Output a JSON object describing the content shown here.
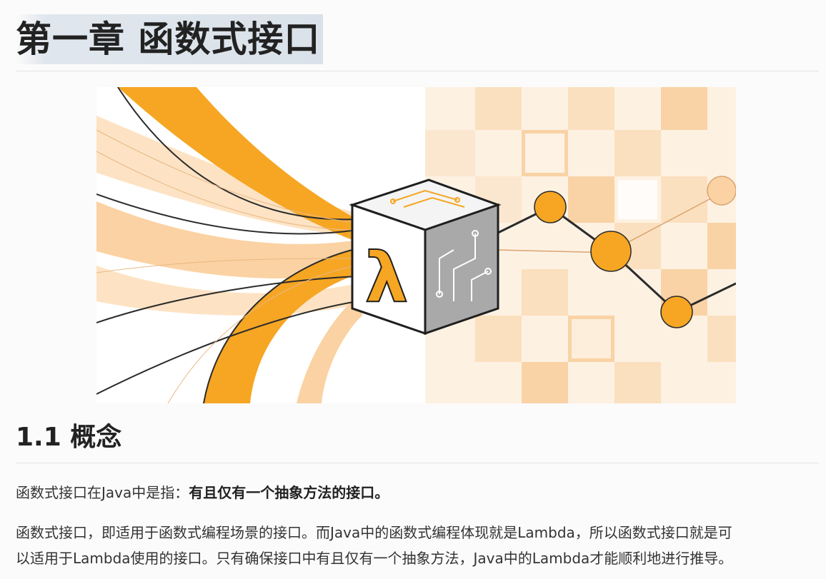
{
  "chapter": {
    "title": "第一章 函数式接口"
  },
  "hero_image": {
    "symbol": "λ",
    "accent_color": "#f6a623",
    "dark_color": "#1f1f1f"
  },
  "section": {
    "title": "1.1 概念",
    "paragraph1": {
      "lead": "函数式接口在Java中是指：",
      "emphasis": "有且仅有一个抽象方法的接口。"
    },
    "paragraph2": {
      "line1": "函数式接口，即适用于函数式编程场景的接口。而Java中的函数式编程体现就是Lambda，所以函数式接口就是可",
      "line2": "以适用于Lambda使用的接口。只有确保接口中有且仅有一个抽象方法，Java中的Lambda才能顺利地进行推导。"
    }
  }
}
